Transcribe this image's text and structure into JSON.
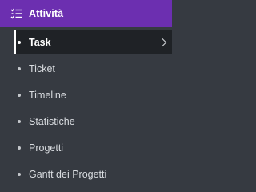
{
  "header": {
    "title": "Attività",
    "icon": "list-icon",
    "background": "#6c2fb0"
  },
  "items": [
    {
      "label": "Task",
      "active": true,
      "icon": "chevron-right-icon"
    },
    {
      "label": "Ticket",
      "active": false
    },
    {
      "label": "Timeline",
      "active": false
    },
    {
      "label": "Statistiche",
      "active": false
    },
    {
      "label": "Progetti",
      "active": false
    },
    {
      "label": "Gantt dei Progetti",
      "active": false
    }
  ],
  "colors": {
    "sidebar_bg": "#363a41",
    "active_bg": "#1f2226",
    "text": "#d9dce0"
  }
}
